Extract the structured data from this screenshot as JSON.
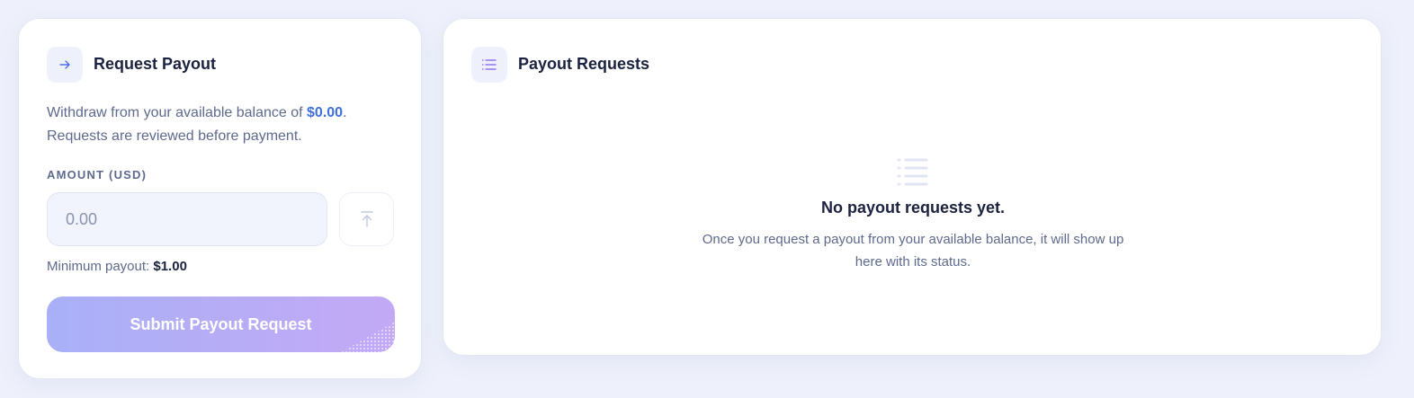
{
  "request_card": {
    "title": "Request Payout",
    "icon": "arrow-right-icon",
    "description_prefix": "Withdraw from your available balance of ",
    "balance": "$0.00",
    "description_suffix": ".",
    "description_line2": "Requests are reviewed before payment.",
    "amount_label": "AMOUNT (USD)",
    "amount_placeholder": "0.00",
    "amount_value": "",
    "max_button_icon": "arrow-up-to-line-icon",
    "minimum_label": "Minimum payout: ",
    "minimum_value": "$1.00",
    "submit_label": "Submit Payout Request"
  },
  "requests_card": {
    "title": "Payout Requests",
    "icon": "list-icon",
    "empty_icon": "list-icon",
    "empty_title": "No payout requests yet.",
    "empty_description": "Once you request a payout from your available balance, it will show up here with its status."
  },
  "colors": {
    "background": "#eef1fb",
    "accent_blue": "#3f6fe0",
    "button_gradient_start": "#a9b0f7",
    "button_gradient_end": "#c3a9f5",
    "icon_purple": "#7b5cf0"
  }
}
